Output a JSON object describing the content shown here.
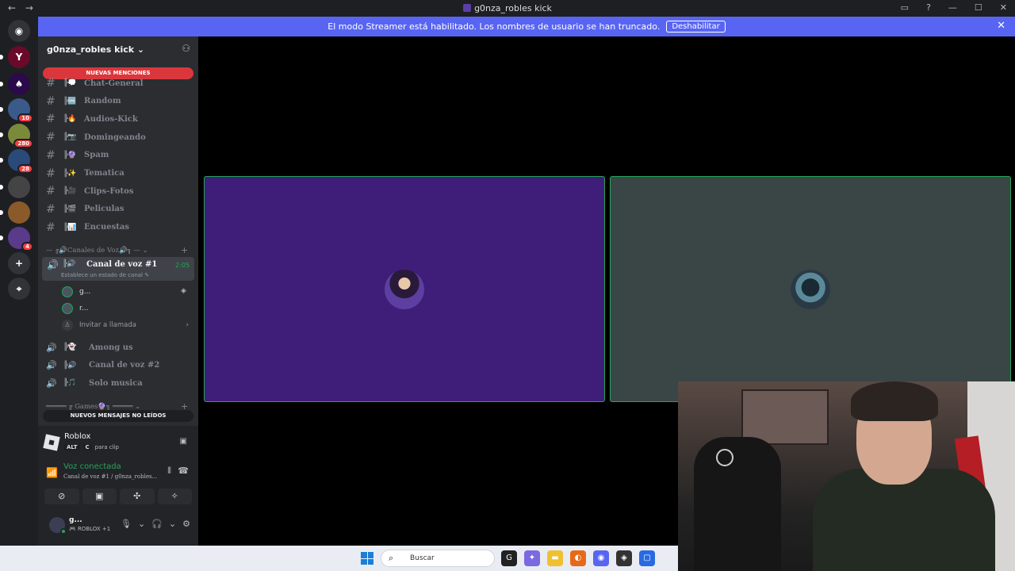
{
  "window": {
    "title": "g0nza_robles kick",
    "nav_back": "←",
    "nav_fwd": "→"
  },
  "banner": {
    "text": "El modo Streamer está habilitado. Los nombres de usuario se han truncado.",
    "button": "Deshabilitar",
    "close": "✕"
  },
  "guilds": [
    {
      "label": "Y",
      "badge": "",
      "color": "#6a0a2a"
    },
    {
      "label": "♠",
      "badge": "",
      "color": "#2a0a4a"
    },
    {
      "label": "",
      "badge": "10",
      "color": "#3a5a8a"
    },
    {
      "label": "",
      "badge": "280",
      "color": "#7a8a3a"
    },
    {
      "label": "",
      "badge": "28",
      "color": "#2a4a7a"
    },
    {
      "label": "",
      "badge": "",
      "color": "#444"
    },
    {
      "label": "",
      "badge": "",
      "color": "#8a5a2a"
    },
    {
      "label": "",
      "badge": "4",
      "color": "#5a3a8a"
    },
    {
      "label": "+",
      "badge": "",
      "color": "#313338"
    },
    {
      "label": "⌖",
      "badge": "",
      "color": "#313338"
    }
  ],
  "server": {
    "name": "g0nza_robles kick",
    "chevron": "⌄",
    "add_icon": "⚇"
  },
  "mentions_pill": "NUEVAS MENCIONES",
  "text_channels": [
    {
      "emoji": "╠💭",
      "name": "Chat-General"
    },
    {
      "emoji": "╠🆒",
      "name": "Random"
    },
    {
      "emoji": "╠🔥",
      "name": "Audios-Kick"
    },
    {
      "emoji": "╠📷",
      "name": "Domingeando"
    },
    {
      "emoji": "╠🔮",
      "name": "Spam"
    },
    {
      "emoji": "╠✨",
      "name": "Tematica"
    },
    {
      "emoji": "╠🎥",
      "name": "Clips-Fotos"
    },
    {
      "emoji": "╠🎬",
      "name": "Peliculas"
    },
    {
      "emoji": "╠📊",
      "name": "Encuestas"
    }
  ],
  "voice_category": "— ╔🔊Canales de Voz🔊╗ — ⌄",
  "active_voice": {
    "name": "Canal de voz #1",
    "time": "2:05",
    "status": "Establece un estado de canal ✎"
  },
  "voice_users": [
    {
      "name": "g..."
    },
    {
      "name": "r..."
    }
  ],
  "invite": "Invitar a llamada",
  "voice_channels": [
    {
      "emoji": "╠👻",
      "name": "Among us"
    },
    {
      "emoji": "╠🔊",
      "name": "Canal de voz #2"
    },
    {
      "emoji": "╠🎵",
      "name": "Solo musica"
    }
  ],
  "games_category": "═════ ╔ Games🔮╗ ═════ ⌄",
  "new_messages_pill": "NUEVOS MENSAJES NO LEÍDOS",
  "activity": {
    "name": "Roblox",
    "key1": "ALT",
    "key2": "C",
    "hint": "para clip"
  },
  "voice_connection": {
    "title": "Voz conectada",
    "subtitle": "Canal de voz #1 / g0nza_robles..."
  },
  "user": {
    "name": "g...",
    "status": "🎮 ROBLOX +1"
  },
  "taskbar": {
    "search_placeholder": "Buscar"
  }
}
